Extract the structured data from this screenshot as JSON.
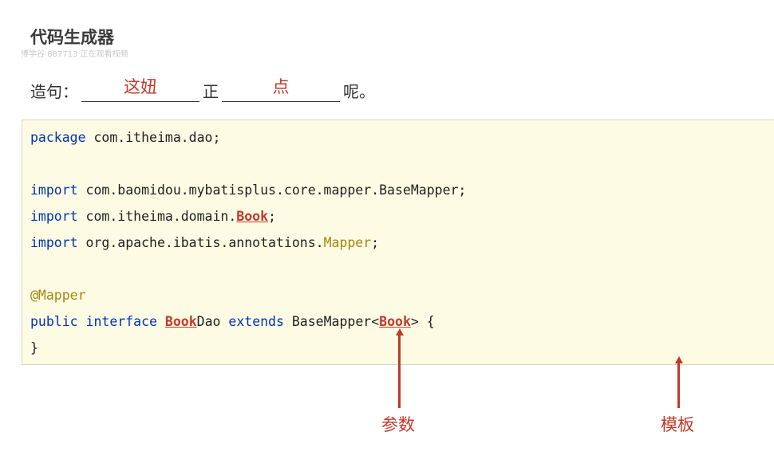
{
  "header": {
    "title": "代码生成器",
    "watermark": "博学谷 887713 正在观看视频"
  },
  "sentence": {
    "prefix": "造句：",
    "blank1": "这妞",
    "middle": "正",
    "blank2": "点",
    "suffix": "呢。"
  },
  "code": {
    "line1": {
      "kw": "package",
      "rest": " com.itheima.dao;"
    },
    "line2": {
      "kw": "import",
      "rest": " com.baomidou.mybatisplus.core.mapper.BaseMapper;"
    },
    "line3": {
      "kw": "import",
      "rest": " com.itheima.domain.",
      "param": "Book",
      "end": ";"
    },
    "line4": {
      "kw": "import",
      "rest": " org.apache.ibatis.annotations.",
      "anno": "Mapper",
      "end": ";"
    },
    "line5": {
      "anno": "@Mapper"
    },
    "line6": {
      "kw1": "public",
      "kw2": "interface",
      "param1": "Book",
      "name": "Dao",
      "kw3": "extends",
      "base": " BaseMapper<",
      "param2": "Book",
      "end": "> {"
    },
    "line7": {
      "text": "}"
    }
  },
  "labels": {
    "param_label": "参数",
    "template_label": "模板"
  },
  "colors": {
    "accent_red": "#c0392b",
    "keyword_blue": "#0033b3",
    "annotation_olive": "#9e880d",
    "code_bg": "#fdfbe4"
  }
}
